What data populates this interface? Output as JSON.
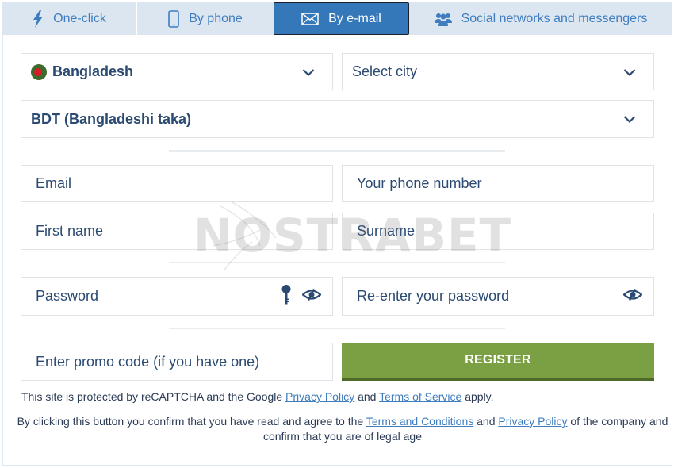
{
  "tabs": [
    {
      "label": "One-click",
      "icon": "lightning-icon",
      "active": false
    },
    {
      "label": "By phone",
      "icon": "smartphone-icon",
      "active": false
    },
    {
      "label": "By e-mail",
      "icon": "envelope-icon",
      "active": true
    },
    {
      "label": "Social networks and messengers",
      "icon": "users-icon",
      "active": false
    }
  ],
  "form": {
    "country": {
      "value": "Bangladesh",
      "flag": "bangladesh-flag"
    },
    "city": {
      "placeholder": "Select city"
    },
    "currency": {
      "value": "BDT (Bangladeshi taka)"
    },
    "email": {
      "placeholder": "Email",
      "value": ""
    },
    "phone": {
      "placeholder": "Your phone number",
      "value": ""
    },
    "first_name": {
      "placeholder": "First name",
      "value": ""
    },
    "surname": {
      "placeholder": "Surname",
      "value": ""
    },
    "password": {
      "placeholder": "Password",
      "value": ""
    },
    "password_repeat": {
      "placeholder": "Re-enter your password",
      "value": ""
    },
    "promo": {
      "placeholder": "Enter promo code (if you have one)",
      "value": ""
    },
    "register_label": "REGISTER"
  },
  "notes": {
    "recaptcha": {
      "prefix": "This site is protected by reCAPTCHA and the Google ",
      "privacy_link": "Privacy Policy",
      "middle": " and ",
      "terms_link": "Terms of Service",
      "suffix": " apply."
    },
    "agreement": {
      "prefix": "By clicking this button you confirm that you have read and agree to the ",
      "terms_link": "Terms and Conditions",
      "middle": " and ",
      "privacy_link": "Privacy Policy",
      "suffix": " of the company and confirm that you are of legal age"
    }
  },
  "watermark": "NOSTRABET",
  "colors": {
    "tab_bg": "#dbe6f0",
    "tab_text": "#3f7dbf",
    "tab_active_bg": "#3478ba",
    "text": "#2b4a72",
    "register_bg": "#7ba043",
    "register_shadow": "#4e6a2b",
    "link": "#3f7dbf"
  }
}
